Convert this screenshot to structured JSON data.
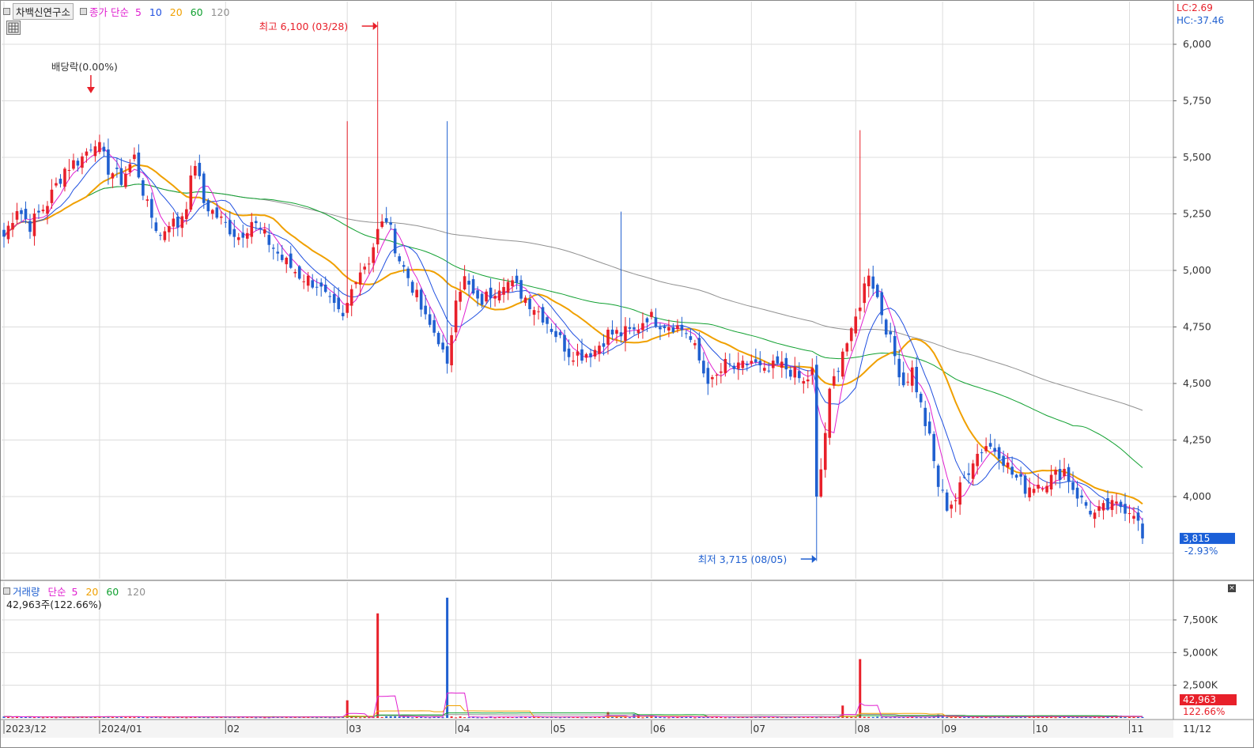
{
  "header": {
    "stock_name": "차백신연구소",
    "price_indicator_label": "종가 단순",
    "ma_labels": [
      "5",
      "10",
      "20",
      "60",
      "120"
    ],
    "lc_label": "LC:2.69",
    "hc_label": "HC:-37.46"
  },
  "volume_header": {
    "label": "거래량",
    "ma_type": "단순",
    "ma_labels": [
      "5",
      "20",
      "60",
      "120"
    ],
    "current_volume_text": "42,963주(122.66%)"
  },
  "colors": {
    "up": "#e8202a",
    "down": "#2060d0",
    "ma5": "#e020d0",
    "ma10": "#2050e0",
    "ma20": "#f0a000",
    "ma60": "#10a030",
    "ma120": "#909090",
    "grid": "#dcdcdc"
  },
  "chart_data": [
    {
      "type": "candlestick",
      "title": "차백신연구소",
      "y_ticks": [
        "6,000",
        "5,750",
        "5,500",
        "5,250",
        "5,000",
        "4,750",
        "4,500",
        "4,250",
        "4,000"
      ],
      "ylim": [
        3620,
        6180
      ],
      "x_tick_labels": [
        "2023/12",
        "2024/01",
        "02",
        "03",
        "04",
        "05",
        "06",
        "07",
        "08",
        "09",
        "10",
        "11",
        "11/12"
      ],
      "annotations": {
        "dividend": "배당락(0.00%)",
        "high": "최고 6,100 (03/28)",
        "low": "최저 3,715 (08/05)"
      },
      "current_price": "3,815",
      "change_pct": "-2.93%",
      "anchors": [
        [
          0,
          5150
        ],
        [
          3,
          5280
        ],
        [
          6,
          5200
        ],
        [
          10,
          5300
        ],
        [
          14,
          5450
        ],
        [
          18,
          5500
        ],
        [
          21,
          5580
        ],
        [
          24,
          5450
        ],
        [
          27,
          5400
        ],
        [
          30,
          5500
        ],
        [
          33,
          5280
        ],
        [
          36,
          5150
        ],
        [
          38,
          5220
        ],
        [
          40,
          5200
        ],
        [
          42,
          5300
        ],
        [
          44,
          5480
        ],
        [
          46,
          5300
        ],
        [
          50,
          5220
        ],
        [
          54,
          5150
        ],
        [
          57,
          5220
        ],
        [
          60,
          5150
        ],
        [
          64,
          5050
        ],
        [
          68,
          4980
        ],
        [
          72,
          4940
        ],
        [
          75,
          4850
        ],
        [
          78,
          4780
        ],
        [
          81,
          4980
        ],
        [
          84,
          5050
        ],
        [
          86,
          5170
        ],
        [
          88,
          5230
        ],
        [
          91,
          5050
        ],
        [
          94,
          4930
        ],
        [
          97,
          4780
        ],
        [
          100,
          4700
        ],
        [
          102,
          4560
        ],
        [
          104,
          4900
        ],
        [
          106,
          4960
        ],
        [
          109,
          4850
        ],
        [
          112,
          4900
        ],
        [
          115,
          4960
        ],
        [
          118,
          4920
        ],
        [
          121,
          4860
        ],
        [
          124,
          4800
        ],
        [
          127,
          4720
        ],
        [
          130,
          4640
        ],
        [
          133,
          4630
        ],
        [
          136,
          4650
        ],
        [
          139,
          4720
        ],
        [
          142,
          4720
        ],
        [
          145,
          4730
        ],
        [
          148,
          4800
        ],
        [
          151,
          4770
        ],
        [
          154,
          4760
        ],
        [
          157,
          4730
        ],
        [
          159,
          4650
        ],
        [
          161,
          4550
        ],
        [
          163,
          4500
        ],
        [
          166,
          4580
        ],
        [
          169,
          4560
        ],
        [
          172,
          4600
        ],
        [
          175,
          4540
        ],
        [
          178,
          4580
        ],
        [
          181,
          4560
        ],
        [
          184,
          4500
        ],
        [
          186,
          4550
        ],
        [
          187,
          3980
        ],
        [
          188,
          4120
        ],
        [
          190,
          4450
        ],
        [
          193,
          4650
        ],
        [
          195,
          4710
        ],
        [
          197,
          4860
        ],
        [
          199,
          5000
        ],
        [
          201,
          4880
        ],
        [
          203,
          4750
        ],
        [
          205,
          4620
        ],
        [
          207,
          4500
        ],
        [
          209,
          4560
        ],
        [
          211,
          4400
        ],
        [
          213,
          4250
        ],
        [
          215,
          4050
        ],
        [
          217,
          3960
        ],
        [
          219,
          3990
        ],
        [
          221,
          4080
        ],
        [
          223,
          4170
        ],
        [
          226,
          4230
        ],
        [
          229,
          4200
        ],
        [
          232,
          4100
        ],
        [
          235,
          4040
        ],
        [
          238,
          4060
        ],
        [
          241,
          4080
        ],
        [
          244,
          4120
        ],
        [
          246,
          4040
        ],
        [
          248,
          3980
        ],
        [
          251,
          3920
        ],
        [
          254,
          3950
        ],
        [
          257,
          3960
        ],
        [
          260,
          3940
        ],
        [
          262,
          3815
        ]
      ]
    },
    {
      "type": "bar",
      "title": "거래량",
      "y_ticks": [
        "7,500K",
        "5,000K",
        "2,500K"
      ],
      "ylim": [
        0,
        10500
      ],
      "current_volume": "42,963",
      "current_pct": "122.66%",
      "units": "K shares",
      "spikes": [
        [
          79,
          1350
        ],
        [
          86,
          8000
        ],
        [
          102,
          9200
        ],
        [
          139,
          450
        ],
        [
          145,
          300
        ],
        [
          146,
          280
        ],
        [
          193,
          950
        ],
        [
          197,
          4500
        ],
        [
          215,
          260
        ],
        [
          241,
          200
        ],
        [
          257,
          180
        ]
      ]
    }
  ]
}
